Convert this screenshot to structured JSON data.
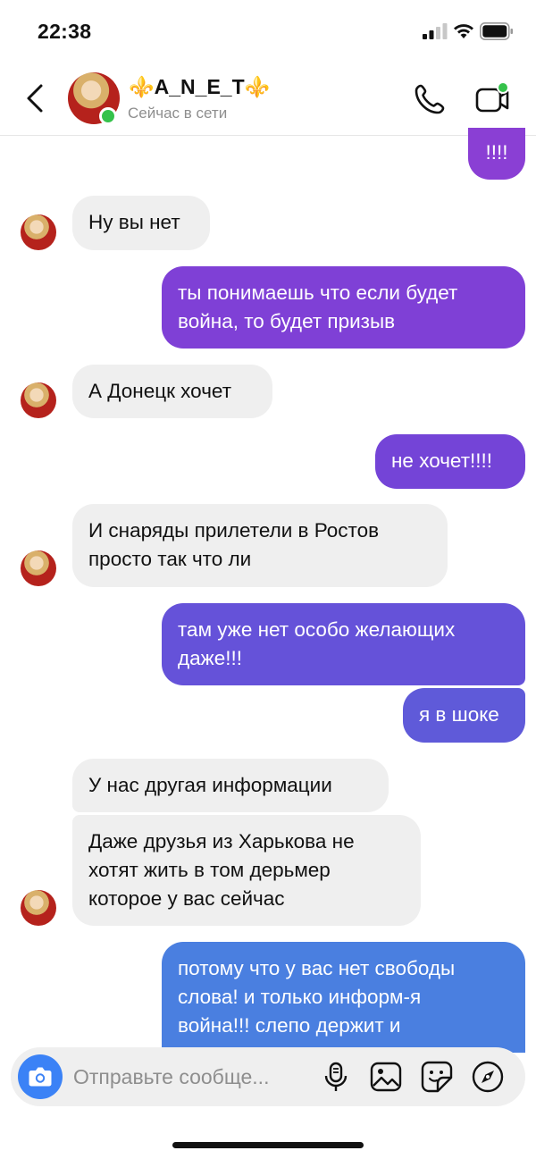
{
  "status_bar": {
    "time": "22:38"
  },
  "header": {
    "contact_name": "⚜️A_N_E_T⚜️",
    "contact_status": "Сейчас в сети"
  },
  "messages": [
    {
      "dir": "out",
      "text": "!!!!"
    },
    {
      "dir": "in",
      "text": "Ну вы нет"
    },
    {
      "dir": "out",
      "text": "ты понимаешь что если будет\nвойна, то будет призыв"
    },
    {
      "dir": "in",
      "text": "А Донецк хочет"
    },
    {
      "dir": "out",
      "text": "не хочет!!!!"
    },
    {
      "dir": "in",
      "text": "И снаряды прилетели в Ростов\nпросто так что ли"
    },
    {
      "dir": "out",
      "text": "там уже нет особо желающих\nдаже!!!"
    },
    {
      "dir": "out",
      "text": "я в шоке"
    },
    {
      "dir": "in",
      "text": "У нас другая информации"
    },
    {
      "dir": "in",
      "text": "Даже друзья из Харькова не\nхотят жить в том дерьмер\nкоторое у вас сейчас"
    },
    {
      "dir": "out",
      "text": "потому что у вас нет свободы\nслова! и только информ-я\nвойна!!! слепо держит и"
    }
  ],
  "composer": {
    "placeholder": "Отправьте сообще..."
  },
  "colors": {
    "bubble_in": "#efefef",
    "online": "#35c24b",
    "camera": "#3b82f6"
  },
  "icons": [
    "back-icon",
    "phone-icon",
    "video-call-icon",
    "camera-icon",
    "microphone-icon",
    "gallery-icon",
    "sticker-icon",
    "compass-icon"
  ]
}
